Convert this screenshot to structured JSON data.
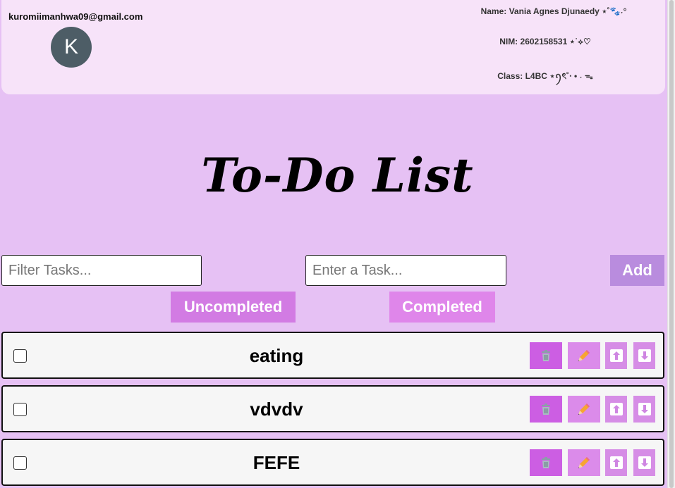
{
  "header": {
    "email": "kuromiimanhwa09@gmail.com",
    "avatar_initial": "K",
    "name_line": "Name: Vania Agnes Djunaedy ⋆˚🐾˖°",
    "nim_line": "NIM: 2602158531 ⋆˙⟡♡",
    "class_line": "Class: L4BC ⋆ꪆৎ˚⋅ • ˖ ᯓ"
  },
  "title": "To-Do List",
  "controls": {
    "filter_placeholder": "Filter Tasks...",
    "task_placeholder": "Enter a Task...",
    "add_label": "Add",
    "uncompleted_label": "Uncompleted",
    "completed_label": "Completed"
  },
  "tasks": [
    {
      "text": "eating",
      "completed": false
    },
    {
      "text": "vdvdv",
      "completed": false
    },
    {
      "text": "FEFE",
      "completed": false
    }
  ],
  "colors": {
    "background": "#e6c1f4",
    "header_card": "#f7e3f9",
    "add_button": "#b98cde",
    "uncompleted_button": "#d27be3",
    "completed_button": "#df86ea",
    "delete_button": "#cc5ee3",
    "edit_button": "#db8bea",
    "move_button": "#d68de6"
  },
  "icons": {
    "delete": "trash-icon",
    "edit": "pencil-icon",
    "up": "arrow-up-icon",
    "down": "arrow-down-icon"
  }
}
